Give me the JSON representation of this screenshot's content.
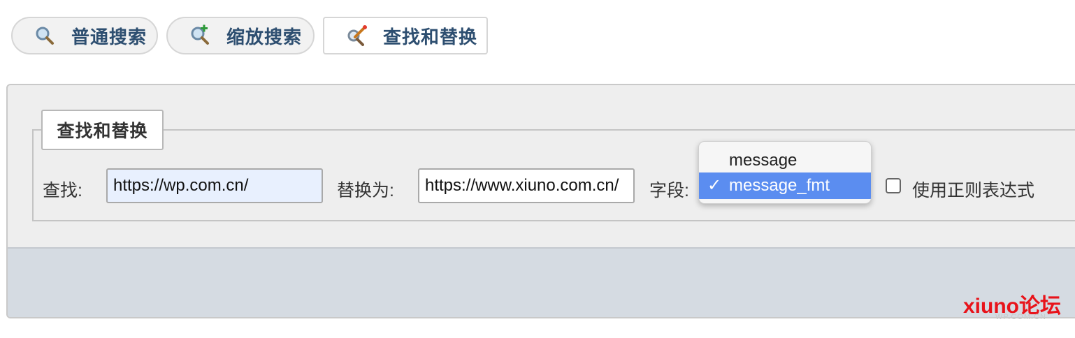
{
  "tabs": [
    {
      "label": "普通搜索",
      "icon": "magnifier-icon"
    },
    {
      "label": "缩放搜索",
      "icon": "zoom-search-icon"
    },
    {
      "label": "查找和替换",
      "icon": "find-replace-icon"
    }
  ],
  "form": {
    "legend": "查找和替换",
    "find_label": "查找:",
    "find_value": "https://wp.com.cn/",
    "replace_label": "替换为:",
    "replace_value": "https://www.xiuno.com.cn/",
    "field_label": "字段:",
    "field_options": [
      "message",
      "message_fmt"
    ],
    "field_selected": "message_fmt",
    "checkmark": "✓",
    "regex_label": "使用正则表达式",
    "regex_checked": false
  },
  "watermark": {
    "text": "xiuno论坛",
    "subtext": "WP.COM.CN"
  },
  "colors": {
    "tab_label": "#2d4e70",
    "selected_option": "#5b8df0",
    "input_autofill": "#e8f0fe",
    "watermark": "#e8131a",
    "footer_bar": "#d5dbe2"
  }
}
